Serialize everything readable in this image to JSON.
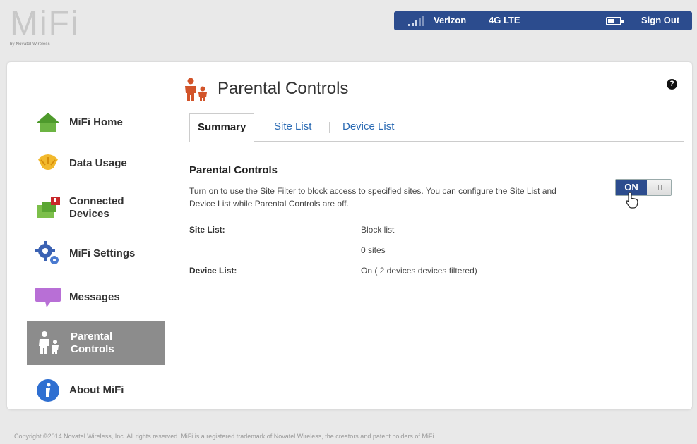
{
  "header": {
    "logo_text": "MiFi",
    "logo_sub": "by Novatel Wireless",
    "carrier": "Verizon",
    "network": "4G LTE",
    "sign_out": "Sign Out"
  },
  "sidebar": {
    "items": [
      {
        "label": "MiFi Home",
        "icon": "home-icon"
      },
      {
        "label": "Data Usage",
        "icon": "gauge-icon"
      },
      {
        "label": "Connected",
        "label2": "Devices",
        "icon": "devices-icon"
      },
      {
        "label": "MiFi Settings",
        "icon": "gear-icon"
      },
      {
        "label": "Messages",
        "icon": "message-icon"
      },
      {
        "label": "Parental",
        "label2": "Controls",
        "icon": "parental-icon"
      },
      {
        "label": "About MiFi",
        "icon": "info-icon"
      }
    ],
    "active_index": 5
  },
  "main": {
    "title": "Parental Controls",
    "tabs": [
      {
        "label": "Summary",
        "active": true
      },
      {
        "label": "Site List",
        "active": false
      },
      {
        "label": "Device List",
        "active": false
      }
    ],
    "section_title": "Parental Controls",
    "description": "Turn on to use the Site Filter to block access to specified sites. You can configure the Site List and Device List while Parental Controls are off.",
    "toggle_label": "ON",
    "toggle_state": "on",
    "rows": {
      "site_list_label": "Site List:",
      "site_list_value": "Block list",
      "site_count": "0 sites",
      "device_list_label": "Device List:",
      "device_list_value": "On ( 2 devices devices filtered)"
    }
  },
  "footer": {
    "text": "Copyright ©2014  Novatel Wireless, Inc. All rights reserved. MiFi is a registered trademark of Novatel Wireless, the creators and patent holders of MiFi."
  },
  "colors": {
    "accent": "#2c4c8e",
    "active_nav": "#8c8c8c",
    "link": "#2a6ab3"
  }
}
